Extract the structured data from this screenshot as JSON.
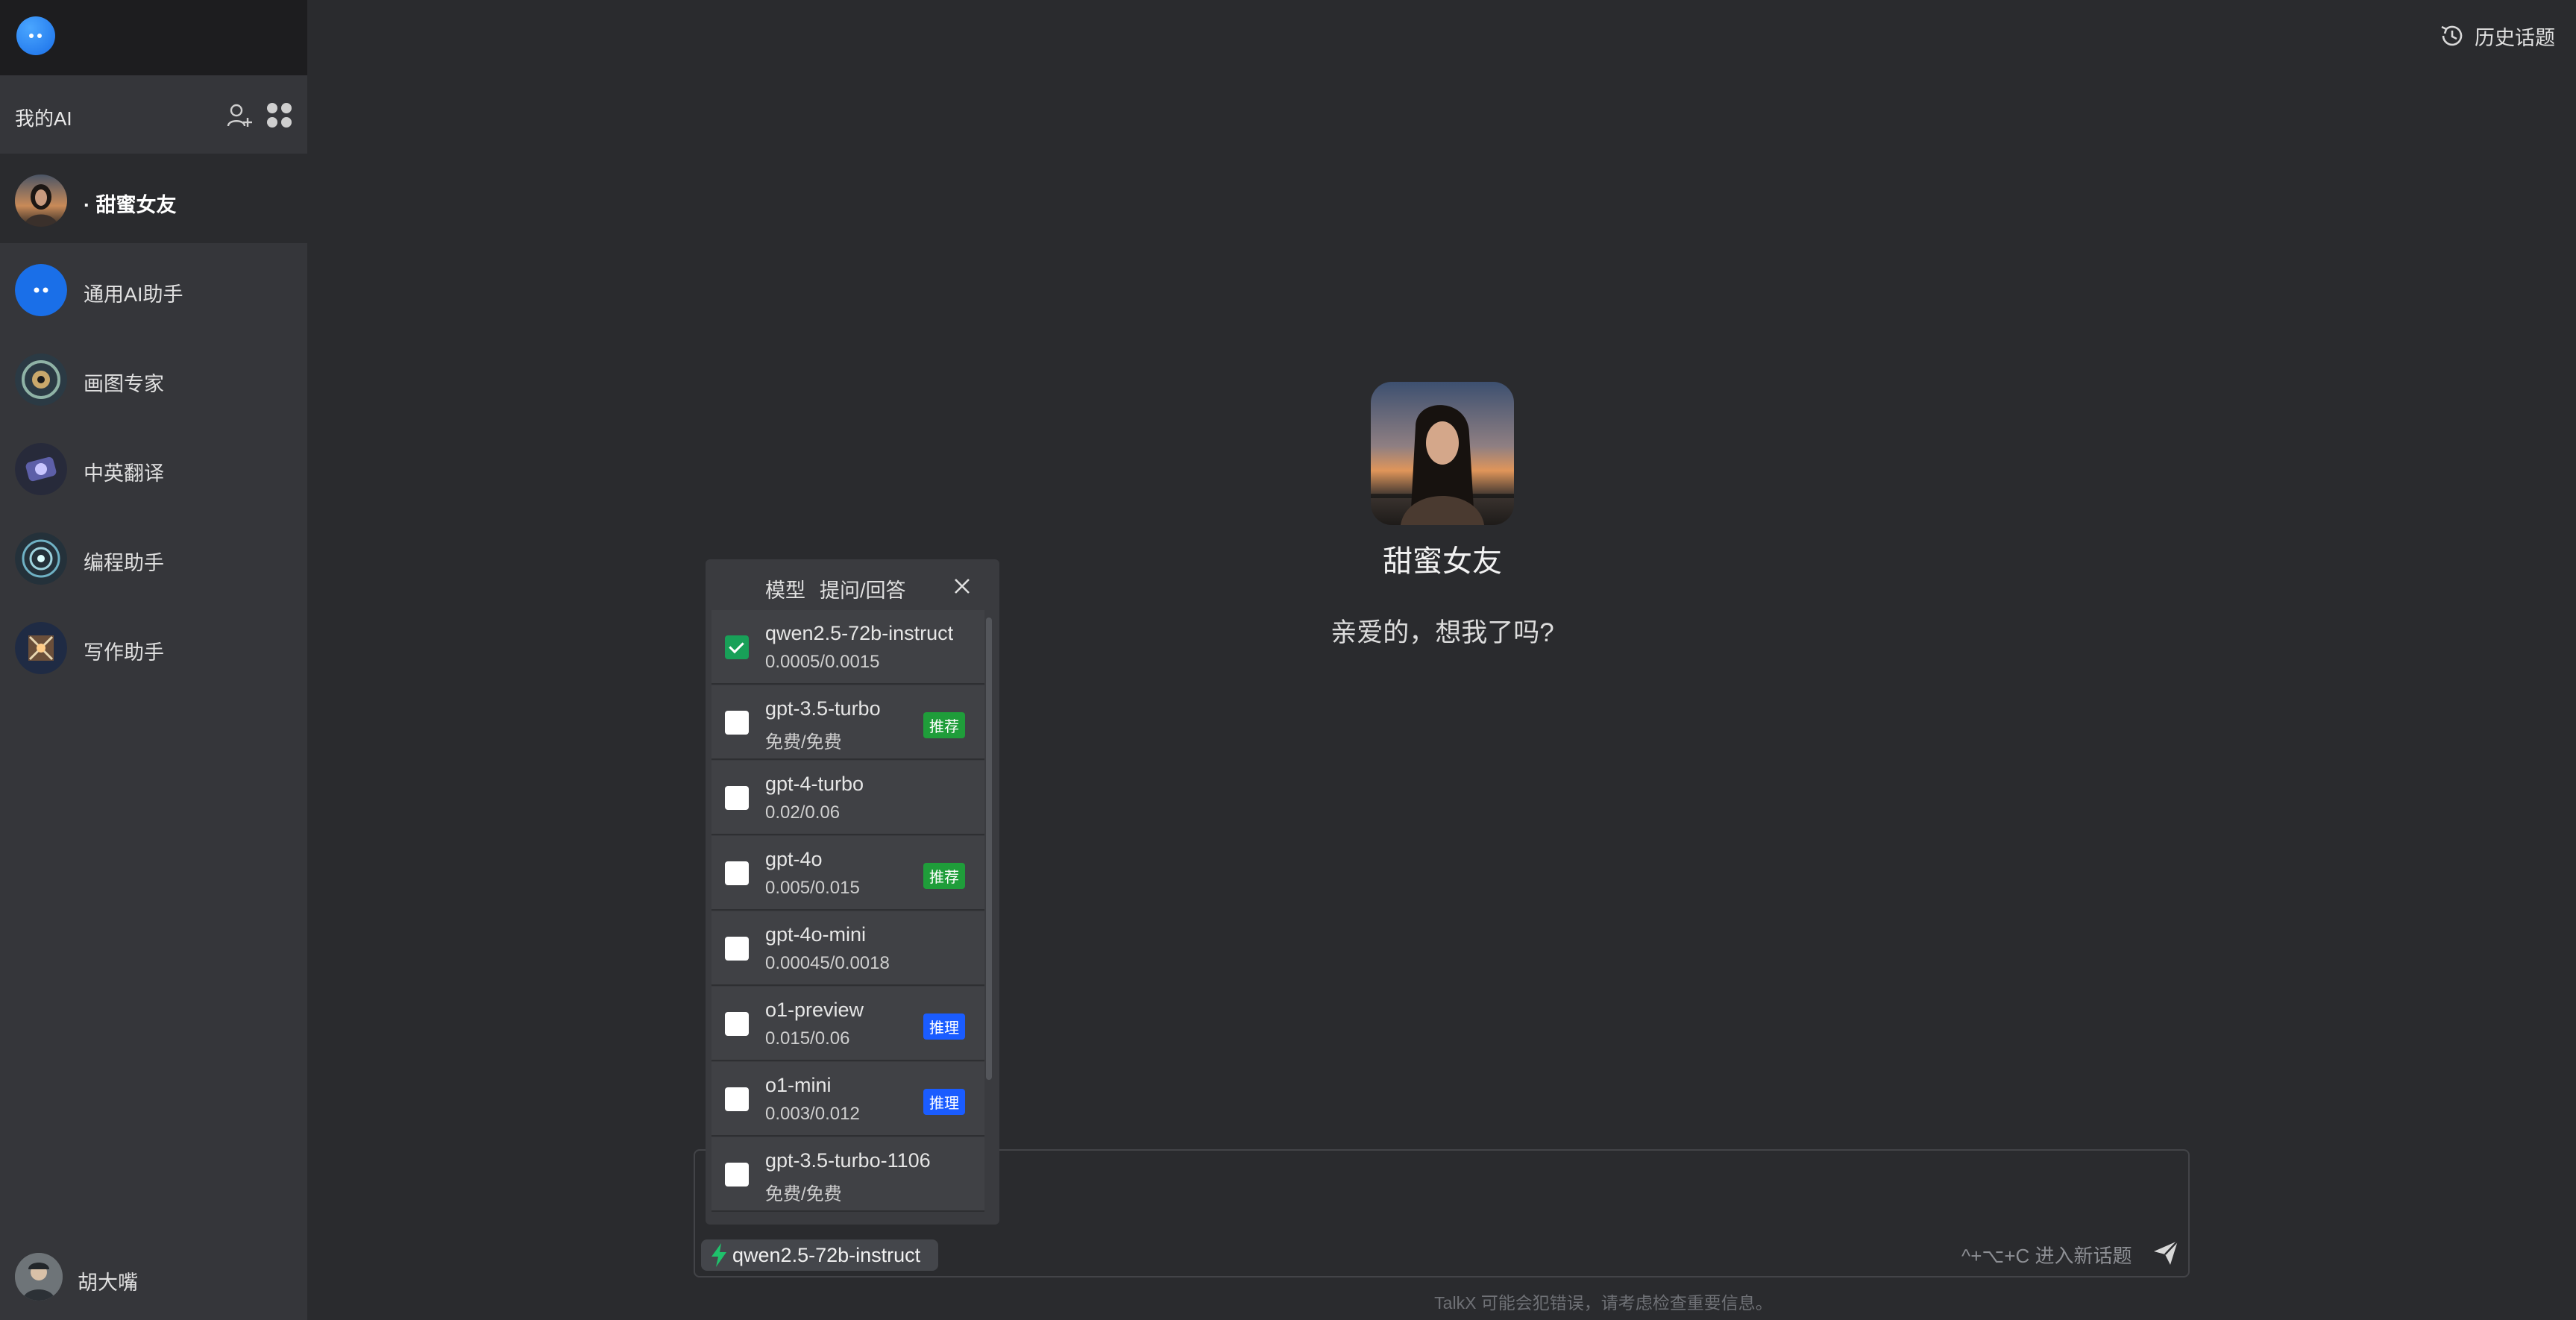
{
  "app": {
    "my_ai_label": "我的AI",
    "history_label": "历史话题"
  },
  "sidebar": {
    "items": [
      {
        "label": "· 甜蜜女友",
        "active": true
      },
      {
        "label": "通用AI助手"
      },
      {
        "label": "画图专家"
      },
      {
        "label": "中英翻译"
      },
      {
        "label": "编程助手"
      },
      {
        "label": "写作助手"
      }
    ],
    "user_name": "胡大嘴"
  },
  "chat": {
    "character_name": "甜蜜女友",
    "greeting": "亲爱的，想我了吗?",
    "selected_model": "qwen2.5-72b-instruct",
    "shortcut_hint": "^+⌥+C 进入新话题",
    "footer_note": "TalkX 可能会犯错误，请考虑检查重要信息。"
  },
  "model_popup": {
    "tabs": [
      "模型",
      "提问/回答"
    ],
    "models": [
      {
        "name": "qwen2.5-72b-instruct",
        "price": "0.0005/0.0015",
        "checked": true,
        "badge": ""
      },
      {
        "name": "gpt-3.5-turbo",
        "price": "免费/免费",
        "checked": false,
        "badge": "推荐"
      },
      {
        "name": "gpt-4-turbo",
        "price": "0.02/0.06",
        "checked": false,
        "badge": ""
      },
      {
        "name": "gpt-4o",
        "price": "0.005/0.015",
        "checked": false,
        "badge": "推荐"
      },
      {
        "name": "gpt-4o-mini",
        "price": "0.00045/0.0018",
        "checked": false,
        "badge": ""
      },
      {
        "name": "o1-preview",
        "price": "0.015/0.06",
        "checked": false,
        "badge": "推理"
      },
      {
        "name": "o1-mini",
        "price": "0.003/0.012",
        "checked": false,
        "badge": "推理"
      },
      {
        "name": "gpt-3.5-turbo-1106",
        "price": "免费/免费",
        "checked": false,
        "badge": ""
      }
    ]
  },
  "colors": {
    "accent_green": "#18a058",
    "badge_green": "#1f9d3a",
    "badge_blue": "#1a5cff",
    "logo_blue": "#1a6fe8"
  }
}
